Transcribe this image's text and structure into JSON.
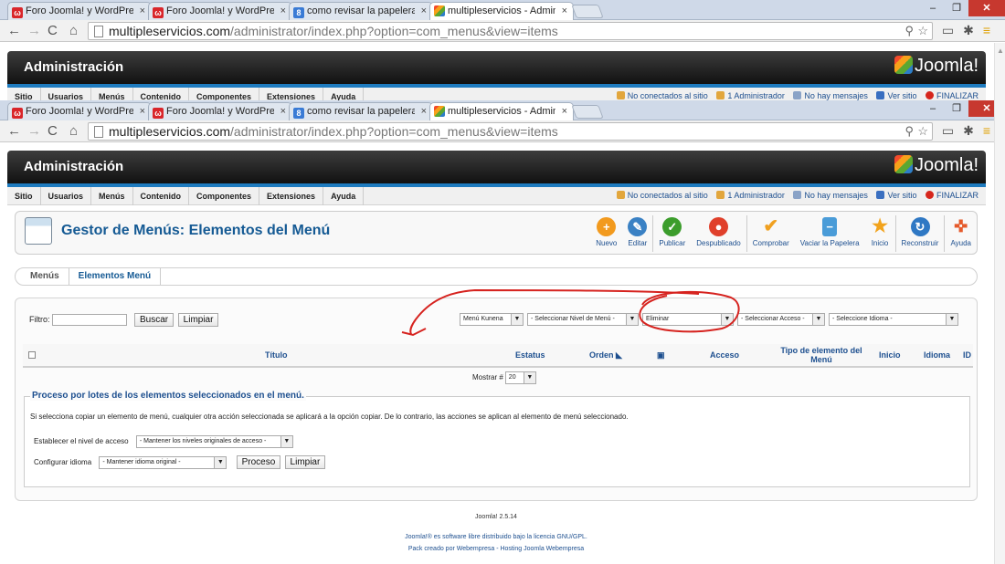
{
  "browser": {
    "tabs": [
      {
        "label": "Foro Joomla! y WordPress",
        "icon": "w"
      },
      {
        "label": "Foro Joomla! y WordPress",
        "icon": "w"
      },
      {
        "label": "como revisar la papelera d",
        "icon": "g"
      },
      {
        "label": "multipleservicios - Admin",
        "icon": "j"
      }
    ],
    "tab_close": "×",
    "url_host": "multipleservicios.com",
    "url_path": "/administrator/index.php?option=com_menus&view=items",
    "win_min": "–",
    "win_max": "❐",
    "win_close": "✕"
  },
  "admin": {
    "title": "Administración",
    "logo_text": "Joomla!",
    "menu": [
      "Sitio",
      "Usuarios",
      "Menús",
      "Contenido",
      "Componentes",
      "Extensiones",
      "Ayuda"
    ],
    "status": {
      "offline": "No conectados al sitio",
      "admins": "1 Administrador",
      "messages": "No hay mensajes",
      "view_site": "Ver sitio",
      "logout": "FINALIZAR"
    }
  },
  "toolbar": {
    "page_title": "Gestor de Menús: Elementos del Menú",
    "buttons": {
      "new": "Nuevo",
      "edit": "Editar",
      "publish": "Publicar",
      "unpublish": "Despublicado",
      "check": "Comprobar",
      "empty_trash": "Vaciar la Papelera",
      "home": "Inicio",
      "rebuild": "Reconstruir",
      "help": "Ayuda"
    }
  },
  "submenu": {
    "menus": "Menús",
    "items": "Elementos Menú"
  },
  "filters": {
    "filter_label": "Filtro:",
    "search_btn": "Buscar",
    "clear_btn": "Limpiar",
    "menu_select": "Menú Kunena",
    "level_select": "- Seleccionar Nivel de Menú -",
    "state_select": "Eliminar",
    "access_select": "- Seleccionar Acceso -",
    "language_select": "- Seleccione Idioma -"
  },
  "table": {
    "title": "Título",
    "status": "Estatus",
    "order": "Orden",
    "access": "Acceso",
    "type": "Tipo de elemento del Menú",
    "home": "Inicio",
    "language": "Idioma",
    "id": "ID"
  },
  "pagination": {
    "label": "Mostrar #",
    "value": "20"
  },
  "batch": {
    "legend": "Proceso por lotes de los elementos seleccionados en el menú.",
    "info": "Si selecciona copiar un elemento de menú, cualquier otra acción seleccionada se aplicará a la opción copiar. De lo contrario, las acciones se aplican al elemento de menú seleccionado.",
    "access_label": "Establecer el nivel de acceso",
    "access_value": "- Mantener los niveles originales de acceso -",
    "language_label": "Configurar idioma",
    "language_value": "- Mantener idioma original -",
    "process_btn": "Proceso",
    "clear_btn": "Limpiar"
  },
  "footer": {
    "version": "Joomla! 2.5.14",
    "license": "Joomla!® es software libre distribuido bajo la licencia GNU/GPL.",
    "credit": "Pack creado por Webempresa - Hosting Joomla Webempresa"
  },
  "colors": {
    "accent": "#1d4f8f",
    "annotation": "#d6231f",
    "admin_bar": "#1a1a1a",
    "stripe": "#1e7bbf"
  }
}
